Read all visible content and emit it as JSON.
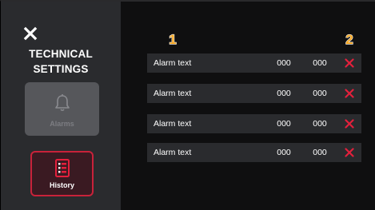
{
  "sidebar": {
    "title_line1": "TECHNICAL",
    "title_line2": "SETTINGS",
    "close_icon": "close-icon",
    "tiles": [
      {
        "label": "Alarms",
        "icon": "bell-icon",
        "state": "disabled"
      },
      {
        "label": "History",
        "icon": "history-list-icon",
        "state": "selected"
      }
    ]
  },
  "badges": [
    "1",
    "2"
  ],
  "alarms": [
    {
      "text": "Alarm text",
      "value1": "000",
      "value2": "000"
    },
    {
      "text": "Alarm text",
      "value1": "000",
      "value2": "000"
    },
    {
      "text": "Alarm text",
      "value1": "000",
      "value2": "000"
    },
    {
      "text": "Alarm text",
      "value1": "000",
      "value2": "000"
    }
  ],
  "colors": {
    "accent_red": "#e4203c",
    "badge_orange": "#f5a623",
    "sidebar_bg": "#2a2b2e",
    "page_bg": "#0f0f10",
    "row_bg": "#2a2b2e"
  }
}
